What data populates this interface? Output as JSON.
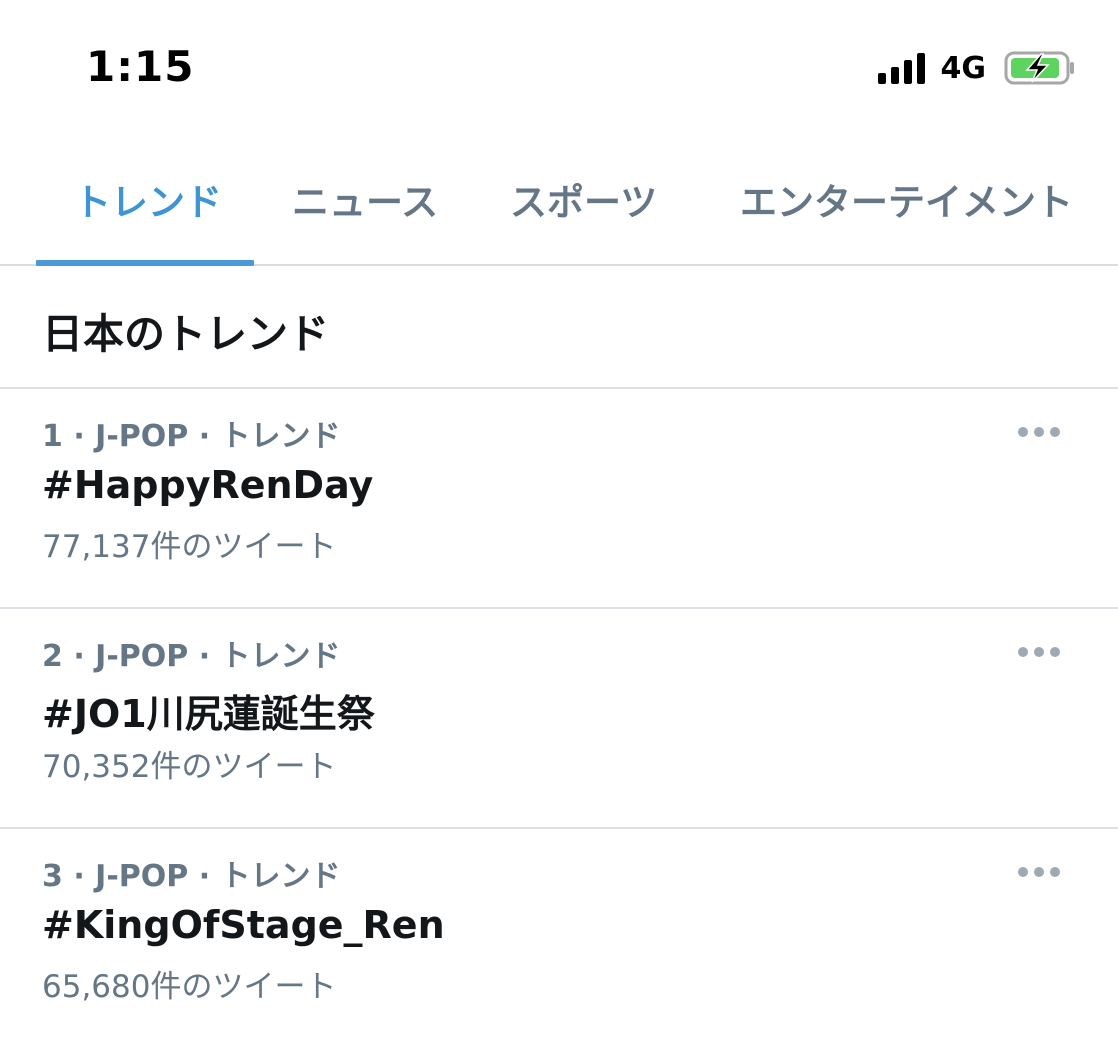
{
  "status_bar": {
    "time": "1:15",
    "network": "4G",
    "icons": [
      "signal-bars-icon",
      "battery-charging-icon"
    ]
  },
  "tabs": [
    {
      "label": "トレンド",
      "active": true
    },
    {
      "label": "ニュース",
      "active": false
    },
    {
      "label": "スポーツ",
      "active": false
    },
    {
      "label": "エンターテイメント",
      "active": false
    }
  ],
  "section": {
    "title": "日本のトレンド"
  },
  "trends": [
    {
      "meta": "1 · J-POP · トレンド",
      "name": "#HappyRenDay",
      "count": "77,137件のツイート"
    },
    {
      "meta": "2 · J-POP · トレンド",
      "name": "#JO1川尻蓮誕生祭",
      "count": "70,352件のツイート"
    },
    {
      "meta": "3 · J-POP · トレンド",
      "name": "#KingOfStage_Ren",
      "count": "65,680件のツイート"
    }
  ],
  "colors": {
    "accent": "#3f95d4",
    "secondary_text": "#657786",
    "primary_text": "#14171a",
    "battery_fill": "#5fd35f"
  }
}
